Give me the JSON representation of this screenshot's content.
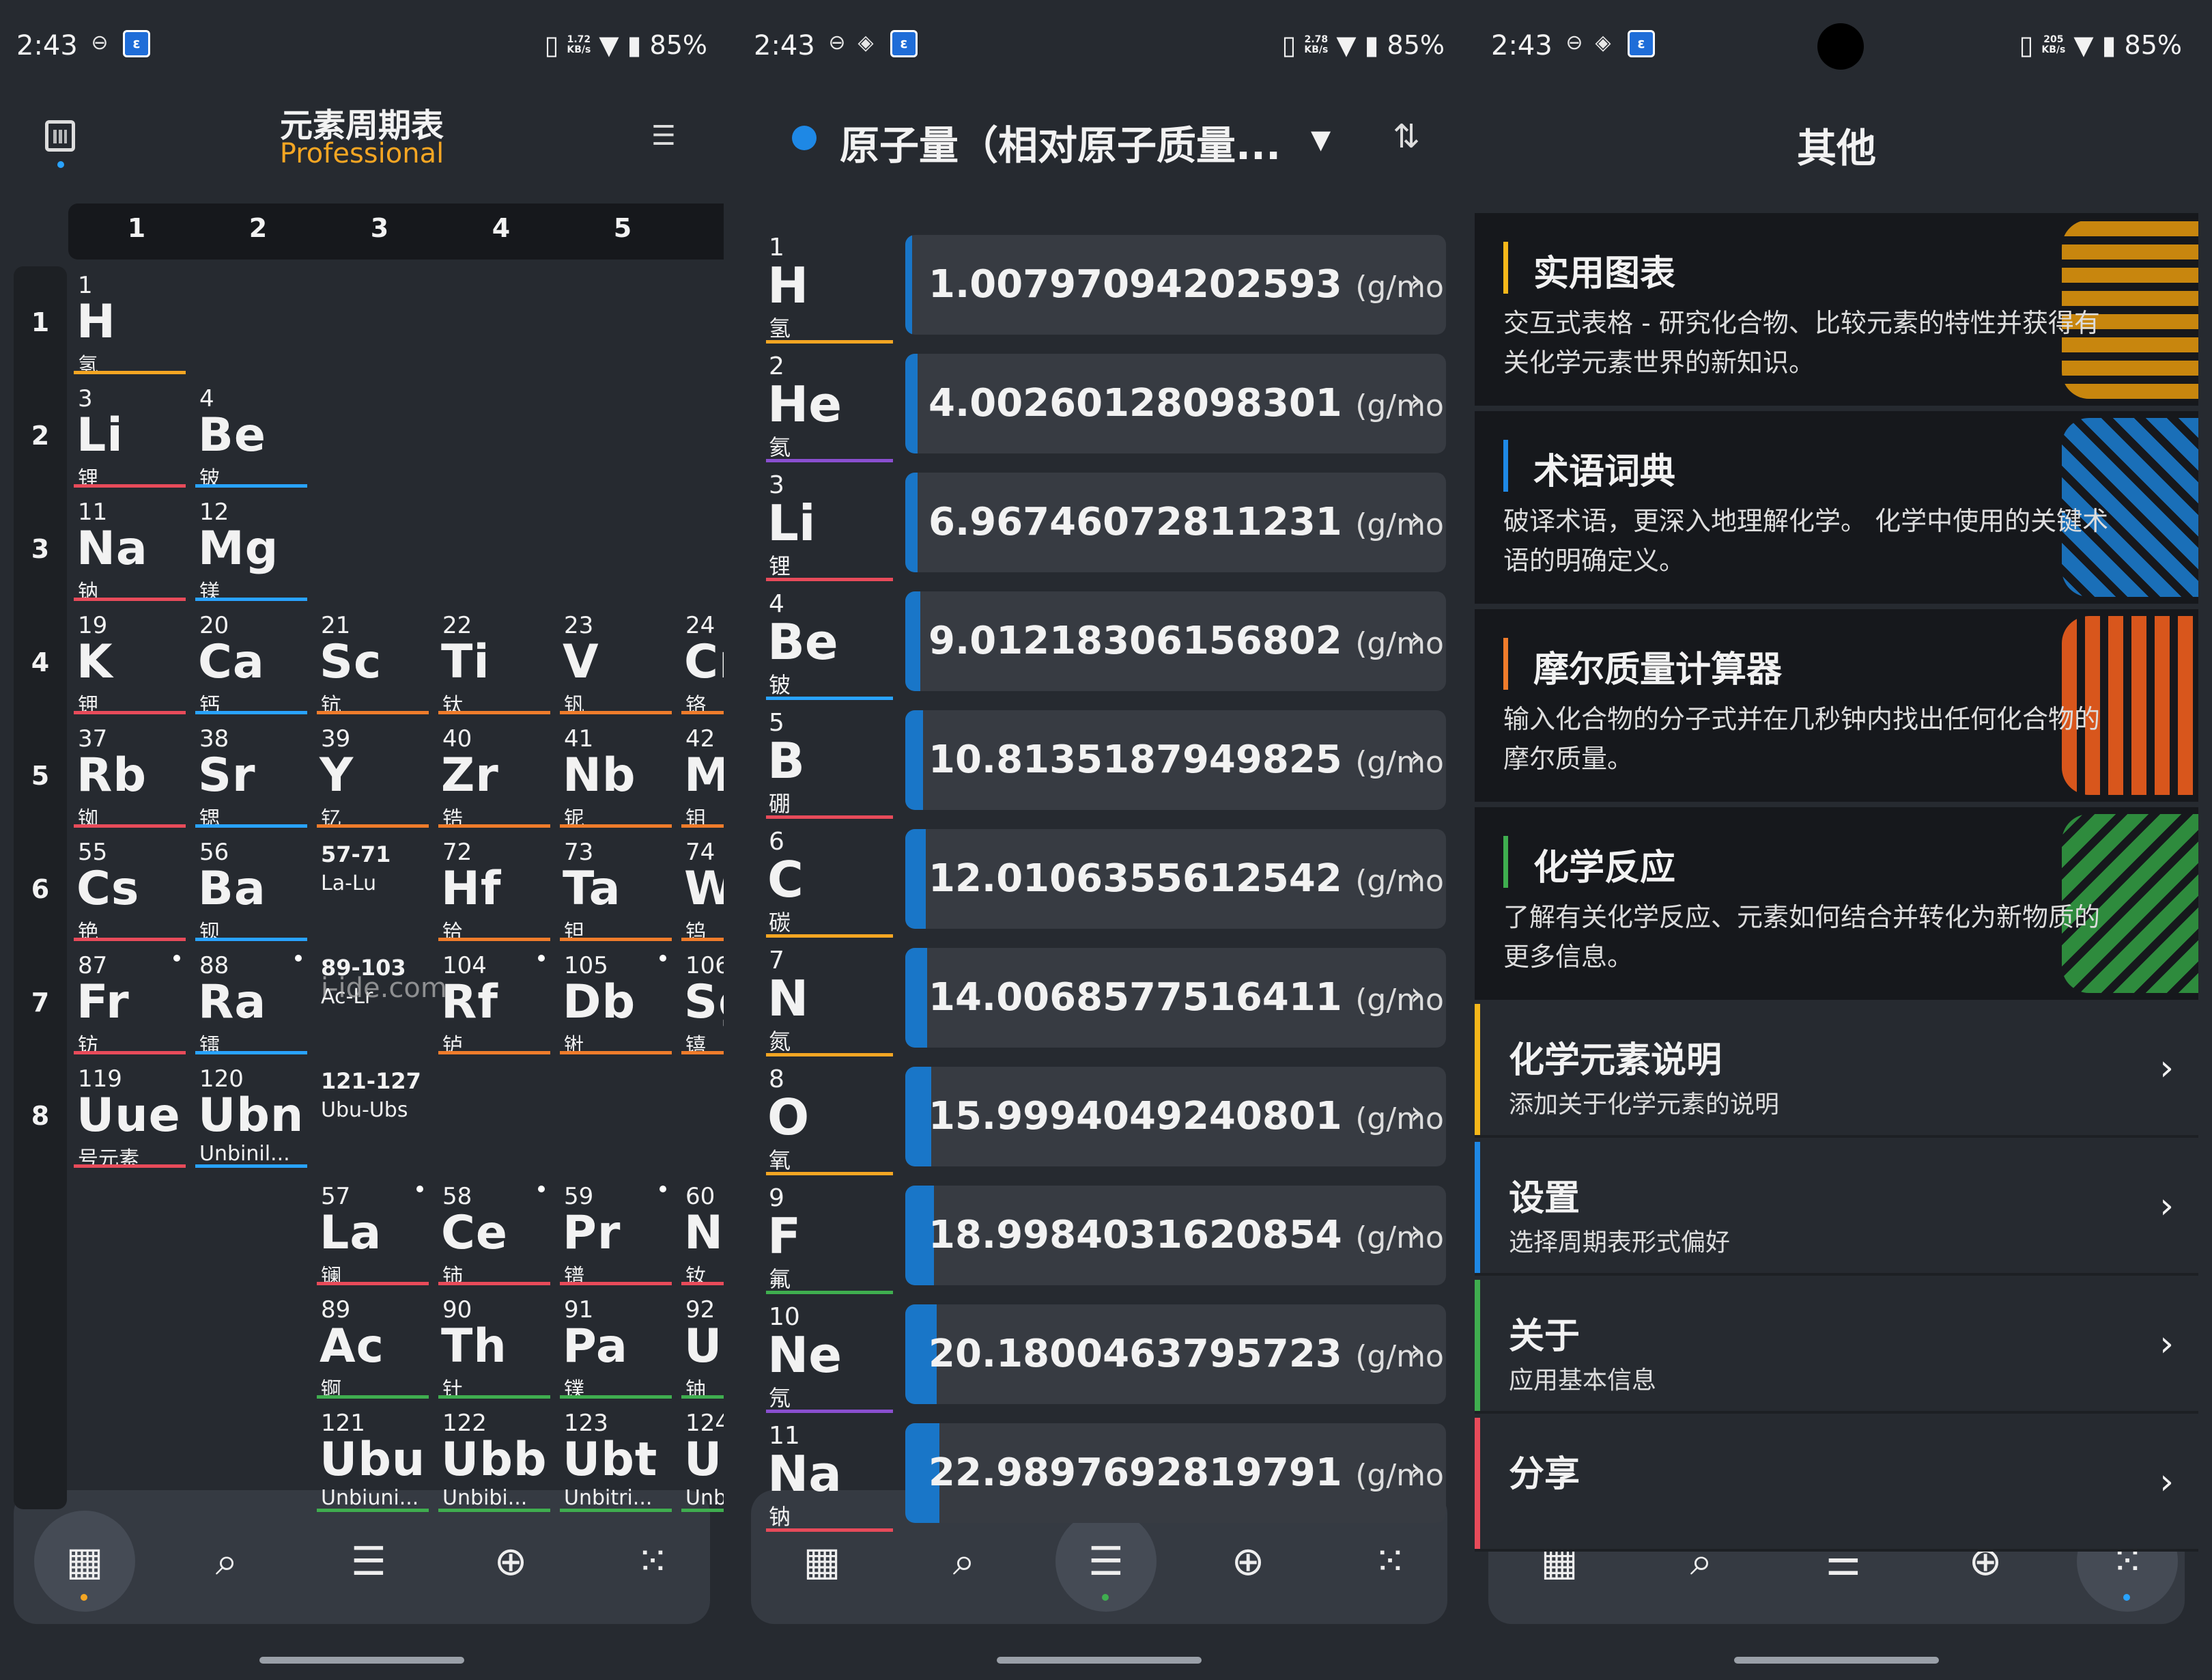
{
  "status": [
    {
      "time": "2:43",
      "speed": "1.72\nKB/s",
      "battery": "85%"
    },
    {
      "time": "2:43",
      "speed": "2.78\nKB/s",
      "battery": "85%"
    },
    {
      "time": "2:43",
      "speed": "205\nKB/s",
      "battery": "85%"
    }
  ],
  "table": {
    "title": "元素周期表",
    "subtitle": "Professional",
    "columns": [
      "1",
      "2",
      "3",
      "4",
      "5"
    ],
    "rows": [
      "1",
      "2",
      "3",
      "4",
      "5",
      "6",
      "7",
      "8"
    ],
    "watermark": "i-ide.com",
    "cells": [
      {
        "n": "1",
        "s": "H",
        "c": "氢",
        "col": 0,
        "row": 0,
        "color": "#f5a623"
      },
      {
        "n": "3",
        "s": "Li",
        "c": "锂",
        "col": 0,
        "row": 1,
        "color": "#e84b5a"
      },
      {
        "n": "4",
        "s": "Be",
        "c": "铍",
        "col": 1,
        "row": 1,
        "color": "#29a3ff"
      },
      {
        "n": "11",
        "s": "Na",
        "c": "钠",
        "col": 0,
        "row": 2,
        "color": "#e84b5a"
      },
      {
        "n": "12",
        "s": "Mg",
        "c": "镁",
        "col": 1,
        "row": 2,
        "color": "#29a3ff"
      },
      {
        "n": "19",
        "s": "K",
        "c": "钾",
        "col": 0,
        "row": 3,
        "color": "#e84b5a"
      },
      {
        "n": "20",
        "s": "Ca",
        "c": "钙",
        "col": 1,
        "row": 3,
        "color": "#29a3ff"
      },
      {
        "n": "21",
        "s": "Sc",
        "c": "钪",
        "col": 2,
        "row": 3,
        "color": "#f07c2b"
      },
      {
        "n": "22",
        "s": "Ti",
        "c": "钛",
        "col": 3,
        "row": 3,
        "color": "#f07c2b"
      },
      {
        "n": "23",
        "s": "V",
        "c": "钒",
        "col": 4,
        "row": 3,
        "color": "#f07c2b"
      },
      {
        "n": "24",
        "s": "Cr",
        "c": "铬",
        "col": 5,
        "row": 3,
        "color": "#f07c2b"
      },
      {
        "n": "37",
        "s": "Rb",
        "c": "铷",
        "col": 0,
        "row": 4,
        "color": "#e84b5a"
      },
      {
        "n": "38",
        "s": "Sr",
        "c": "锶",
        "col": 1,
        "row": 4,
        "color": "#29a3ff"
      },
      {
        "n": "39",
        "s": "Y",
        "c": "钇",
        "col": 2,
        "row": 4,
        "color": "#f07c2b"
      },
      {
        "n": "40",
        "s": "Zr",
        "c": "锆",
        "col": 3,
        "row": 4,
        "color": "#f07c2b"
      },
      {
        "n": "41",
        "s": "Nb",
        "c": "铌",
        "col": 4,
        "row": 4,
        "color": "#f07c2b"
      },
      {
        "n": "42",
        "s": "Mo",
        "c": "钼",
        "col": 5,
        "row": 4,
        "color": "#f07c2b"
      },
      {
        "n": "55",
        "s": "Cs",
        "c": "铯",
        "col": 0,
        "row": 5,
        "color": "#e84b5a"
      },
      {
        "n": "56",
        "s": "Ba",
        "c": "钡",
        "col": 1,
        "row": 5,
        "color": "#29a3ff"
      },
      {
        "n": "72",
        "s": "Hf",
        "c": "铪",
        "col": 3,
        "row": 5,
        "color": "#f07c2b"
      },
      {
        "n": "73",
        "s": "Ta",
        "c": "钽",
        "col": 4,
        "row": 5,
        "color": "#f07c2b"
      },
      {
        "n": "74",
        "s": "W",
        "c": "钨",
        "col": 5,
        "row": 5,
        "color": "#f07c2b"
      },
      {
        "n": "87",
        "s": "Fr",
        "c": "钫",
        "col": 0,
        "row": 6,
        "color": "#e84b5a",
        "dot": true
      },
      {
        "n": "88",
        "s": "Ra",
        "c": "镭",
        "col": 1,
        "row": 6,
        "color": "#29a3ff",
        "dot": true
      },
      {
        "n": "104",
        "s": "Rf",
        "c": "𬬻",
        "col": 3,
        "row": 6,
        "color": "#f07c2b",
        "dot": true
      },
      {
        "n": "105",
        "s": "Db",
        "c": "𬭊",
        "col": 4,
        "row": 6,
        "color": "#f07c2b",
        "dot": true
      },
      {
        "n": "106",
        "s": "Sg",
        "c": "𬭳",
        "col": 5,
        "row": 6,
        "color": "#f07c2b"
      },
      {
        "n": "119",
        "s": "Uue",
        "c": "号元素",
        "col": 0,
        "row": 7,
        "color": "#e84b5a"
      },
      {
        "n": "120",
        "s": "Ubn",
        "c": "Unbinil...",
        "col": 1,
        "row": 7,
        "color": "#29a3ff"
      },
      {
        "n": "57",
        "s": "La",
        "c": "镧",
        "col": 2,
        "row": 8,
        "color": "#e84b5a",
        "dot": true
      },
      {
        "n": "58",
        "s": "Ce",
        "c": "铈",
        "col": 3,
        "row": 8,
        "color": "#e84b5a",
        "dot": true
      },
      {
        "n": "59",
        "s": "Pr",
        "c": "镨",
        "col": 4,
        "row": 8,
        "color": "#e84b5a",
        "dot": true
      },
      {
        "n": "60",
        "s": "Nd",
        "c": "钕",
        "col": 5,
        "row": 8,
        "color": "#e84b5a"
      },
      {
        "n": "89",
        "s": "Ac",
        "c": "锕",
        "col": 2,
        "row": 9,
        "color": "#3fae4f"
      },
      {
        "n": "90",
        "s": "Th",
        "c": "钍",
        "col": 3,
        "row": 9,
        "color": "#3fae4f"
      },
      {
        "n": "91",
        "s": "Pa",
        "c": "镤",
        "col": 4,
        "row": 9,
        "color": "#3fae4f"
      },
      {
        "n": "92",
        "s": "U",
        "c": "铀",
        "col": 5,
        "row": 9,
        "color": "#3fae4f"
      },
      {
        "n": "121",
        "s": "Ubu",
        "c": "Unbiuni...",
        "col": 2,
        "row": 10,
        "color": "#3fae4f"
      },
      {
        "n": "122",
        "s": "Ubb",
        "c": "Unbibi...",
        "col": 3,
        "row": 10,
        "color": "#3fae4f"
      },
      {
        "n": "123",
        "s": "Ubt",
        "c": "Unbitri...",
        "col": 4,
        "row": 10,
        "color": "#3fae4f"
      },
      {
        "n": "124",
        "s": "Ubq",
        "c": "Unbiq...",
        "col": 5,
        "row": 10,
        "color": "#3fae4f"
      }
    ],
    "ranges": [
      {
        "r": "57-71",
        "s": "La-Lu",
        "col": 2,
        "row": 5
      },
      {
        "r": "89-103",
        "s": "Ac-Lr",
        "col": 2,
        "row": 6
      },
      {
        "r": "121-127",
        "s": "Ubu-Ubs",
        "col": 2,
        "row": 7
      }
    ]
  },
  "mass": {
    "title": "原子量（相对原子质量...",
    "unit": "(g/mol)",
    "rows": [
      {
        "n": "1",
        "s": "H",
        "c": "氢",
        "v": "1.00797094202593",
        "color": "#f5a623",
        "fill": 0.0
      },
      {
        "n": "2",
        "s": "He",
        "c": "氦",
        "v": "4.00260128098301",
        "color": "#8a4fd0",
        "fill": 0.01
      },
      {
        "n": "3",
        "s": "Li",
        "c": "锂",
        "v": "6.96746072811231",
        "color": "#e84b5a",
        "fill": 0.01
      },
      {
        "n": "4",
        "s": "Be",
        "c": "铍",
        "v": "9.01218306156802",
        "color": "#29a3ff",
        "fill": 0.015
      },
      {
        "n": "5",
        "s": "B",
        "c": "硼",
        "v": "10.8135187949825",
        "color": "#e84b5a",
        "fill": 0.02
      },
      {
        "n": "6",
        "s": "C",
        "c": "碳",
        "v": "12.0106355612542",
        "color": "#f5a623",
        "fill": 0.025
      },
      {
        "n": "7",
        "s": "N",
        "c": "氮",
        "v": "14.0068577516411",
        "color": "#f5a623",
        "fill": 0.028
      },
      {
        "n": "8",
        "s": "O",
        "c": "氧",
        "v": "15.9994049240801",
        "color": "#f5a623",
        "fill": 0.035
      },
      {
        "n": "9",
        "s": "F",
        "c": "氟",
        "v": "18.9984031620854",
        "color": "#3fae4f",
        "fill": 0.04
      },
      {
        "n": "10",
        "s": "Ne",
        "c": "氖",
        "v": "20.1800463795723",
        "color": "#8a4fd0",
        "fill": 0.045
      },
      {
        "n": "11",
        "s": "Na",
        "c": "钠",
        "v": "22.9897692819791",
        "color": "#e84b5a",
        "fill": 0.05
      }
    ]
  },
  "other": {
    "title": "其他",
    "cards": [
      {
        "t": "实用图表",
        "d": "交互式表格 - 研究化合物、比较元素的特性并获得有关化学元素世界的新知识。",
        "color": "#f5b71a",
        "art": "#c8860e"
      },
      {
        "t": "术语词典",
        "d": "破译术语，更深入地理解化学。 化学中使用的关键术语的明确定义。",
        "color": "#1e88e5",
        "art": "#1a6fb8"
      },
      {
        "t": "摩尔质量计算器",
        "d": "输入化合物的分子式并在几秒钟内找出任何化合物的摩尔质量。",
        "color": "#f07c2b",
        "art": "#d8561c"
      },
      {
        "t": "化学反应",
        "d": "了解有关化学反应、元素如何结合并转化为新物质的更多信息。",
        "color": "#3fae4f",
        "art": "#2e8b3d"
      }
    ],
    "rows": [
      {
        "t": "化学元素说明",
        "d": "添加关于化学元素的说明",
        "color": "#f5b71a"
      },
      {
        "t": "设置",
        "d": "选择周期表形式偏好",
        "color": "#1e88e5"
      },
      {
        "t": "关于",
        "d": "应用基本信息",
        "color": "#3fae4f"
      },
      {
        "t": "分享",
        "d": "",
        "color": "#e84b5a"
      }
    ]
  },
  "nav": {
    "icons": [
      "table-icon",
      "search-icon",
      "list-icon",
      "add-atom-icon",
      "molecule-icon"
    ],
    "glyphs": [
      "▦",
      "⌕",
      "☰",
      "⊕",
      "⁙"
    ],
    "active": [
      0,
      2,
      4
    ],
    "dot_colors": [
      "#f5a623",
      "#3fae4f",
      "#29a3ff"
    ]
  }
}
